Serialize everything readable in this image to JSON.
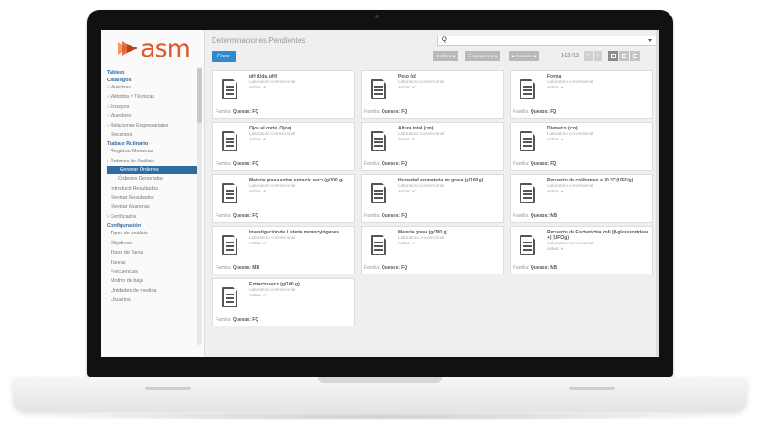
{
  "app": {
    "logo_text": "asm"
  },
  "sidebar": {
    "groups": [
      {
        "label": "Tablero",
        "type": "sec"
      },
      {
        "label": "Catálogos",
        "type": "sec"
      },
      {
        "label": "› Muestras",
        "type": "it"
      },
      {
        "label": "› Métodos y Técnicas",
        "type": "it"
      },
      {
        "label": "› Ensayos",
        "type": "it"
      },
      {
        "label": "› Muestreo",
        "type": "it"
      },
      {
        "label": "› Relaciones Empresariales",
        "type": "it"
      },
      {
        "label": "Recursos",
        "type": "sub"
      },
      {
        "label": "Trabajo Rutinario",
        "type": "sec"
      },
      {
        "label": "Registrar Muestras",
        "type": "sub"
      },
      {
        "label": "› Órdenes de Análisis",
        "type": "it"
      },
      {
        "label": "Generar Órdenes",
        "type": "active"
      },
      {
        "label": "Órdenes Generadas",
        "type": "sub2"
      },
      {
        "label": "Introducir Resultados",
        "type": "sub"
      },
      {
        "label": "Revisar Resultados",
        "type": "sub"
      },
      {
        "label": "Revisar Muestras",
        "type": "sub"
      },
      {
        "label": "› Certificados",
        "type": "it"
      },
      {
        "label": "Configuración",
        "type": "sec"
      },
      {
        "label": "Tipos de análisis",
        "type": "sub"
      },
      {
        "label": "Objetivos",
        "type": "sub"
      },
      {
        "label": "Tipos de Tarea",
        "type": "sub"
      },
      {
        "label": "Tareas",
        "type": "sub"
      },
      {
        "label": "Frecuencias",
        "type": "sub"
      },
      {
        "label": "Motivo de baja",
        "type": "sub"
      },
      {
        "label": "Unidades de medida",
        "type": "sub"
      },
      {
        "label": "Usuarios",
        "type": "sub"
      }
    ]
  },
  "header": {
    "title": "Determinaciones Pendientes",
    "create_label": "Crear",
    "search_value": "Q|",
    "filters_label": "▼ Filtros ▾",
    "group_label": "☰ Agrupar por ▾",
    "favorites_label": "★ Favoritos ▾",
    "pager_text": "1-13 / 13",
    "prev": "‹",
    "next": "›"
  },
  "cards": [
    {
      "title": "pH (Uds. pH)",
      "lab": "Laboratorio convencional",
      "active": "Activo: ✔",
      "family_label": "Familia:",
      "family": "Quesos: FQ"
    },
    {
      "title": "Peso (g)",
      "lab": "Laboratorio convencional",
      "active": "Activo: ✔",
      "family_label": "Familia:",
      "family": "Quesos: FQ"
    },
    {
      "title": "Forma",
      "lab": "Laboratorio convencional",
      "active": "Activo: ✔",
      "family_label": "Familia:",
      "family": "Quesos: FQ"
    },
    {
      "title": "Ojos al corte (Ojos)",
      "lab": "Laboratorio convencional",
      "active": "Activo: ✔",
      "family_label": "Familia:",
      "family": "Quesos: FQ"
    },
    {
      "title": "Altura total (cm)",
      "lab": "Laboratorio convencional",
      "active": "Activo: ✔",
      "family_label": "Familia:",
      "family": "Quesos: FQ"
    },
    {
      "title": "Diámetro (cm)",
      "lab": "Laboratorio convencional",
      "active": "Activo: ✔",
      "family_label": "Familia:",
      "family": "Quesos: FQ"
    },
    {
      "title": "Materia grasa sobre extracto seco (g/100 g)",
      "lab": "Laboratorio convencional",
      "active": "Activo: ✔",
      "family_label": "Familia:",
      "family": "Quesos: FQ"
    },
    {
      "title": "Humedad en materia no grasa (g/100 g)",
      "lab": "Laboratorio convencional",
      "active": "Activo: ✔",
      "family_label": "Familia:",
      "family": "Quesos: FQ"
    },
    {
      "title": "Recuento de coliformes a 30 °C (UFC/g)",
      "lab": "Laboratorio convencional",
      "active": "Activo: ✔",
      "family_label": "Familia:",
      "family": "Quesos: MB"
    },
    {
      "title": "Investigación de Listeria monocytógenes",
      "lab": "Laboratorio convencional",
      "active": "Activo: ✔",
      "family_label": "Familia:",
      "family": "Quesos: MB"
    },
    {
      "title": "Materia grasa (g/100 g)",
      "lab": "Laboratorio convencional",
      "active": "Activo: ✔",
      "family_label": "Familia:",
      "family": "Quesos: FQ"
    },
    {
      "title": "Recuento de Escherichia coli (β-glucuronidasa +) (UFC/g)",
      "lab": "Laboratorio convencional",
      "active": "Activo: ✔",
      "family_label": "Familia:",
      "family": "Quesos: MB"
    },
    {
      "title": "Extracto seco (g/100 g)",
      "lab": "Laboratorio convencional",
      "active": "Activo: ✔",
      "family_label": "Familia:",
      "family": "Quesos: FQ"
    }
  ],
  "colors": {
    "accent": "#2e6da4",
    "logo": "#e0582a",
    "create": "#2e8bd0"
  }
}
